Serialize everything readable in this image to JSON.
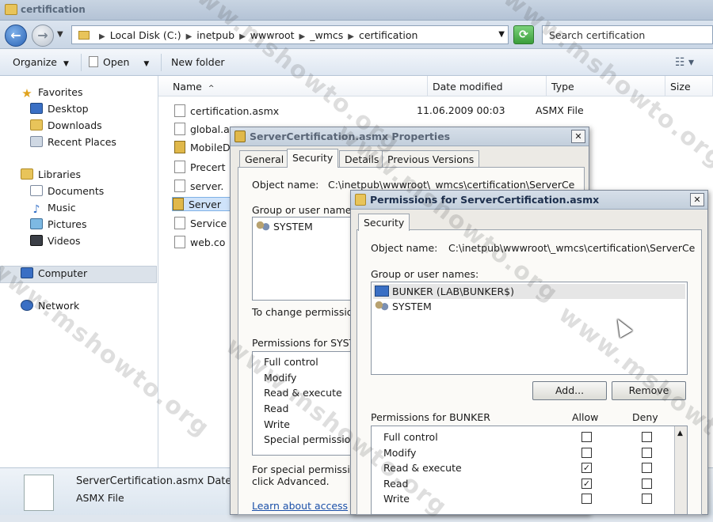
{
  "window": {
    "title": "certification"
  },
  "address": {
    "crumbs": [
      "Local Disk (C:)",
      "inetpub",
      "wwwroot",
      "_wmcs",
      "certification"
    ],
    "search_placeholder": "Search certification"
  },
  "toolbar": {
    "organize": "Organize",
    "open": "Open",
    "new_folder": "New folder"
  },
  "nav": {
    "favorites": "Favorites",
    "desktop": "Desktop",
    "downloads": "Downloads",
    "recent": "Recent Places",
    "libraries": "Libraries",
    "documents": "Documents",
    "music": "Music",
    "pictures": "Pictures",
    "videos": "Videos",
    "computer": "Computer",
    "network": "Network"
  },
  "columns": {
    "name": "Name",
    "date": "Date modified",
    "type": "Type",
    "size": "Size"
  },
  "files": [
    {
      "name": "certification.asmx",
      "date": "11.06.2009 00:03",
      "type": "ASMX File"
    },
    {
      "name": "global.a"
    },
    {
      "name": "MobileD"
    },
    {
      "name": "Precert"
    },
    {
      "name": "server."
    },
    {
      "name": "Server"
    },
    {
      "name": "Service"
    },
    {
      "name": "web.co"
    }
  ],
  "details": {
    "name": "ServerCertification.asmx  Date",
    "type": "ASMX File"
  },
  "properties": {
    "title": "ServerCertification.asmx Properties",
    "tabs": [
      "General",
      "Security",
      "Details",
      "Previous Versions"
    ],
    "object_label": "Object name:",
    "object_value": "C:\\inetpub\\wwwroot\\_wmcs\\certification\\ServerCe",
    "group_label": "Group or user names",
    "users": [
      "SYSTEM"
    ],
    "change_text": "To change permissio",
    "perms_for": "Permissions for SYST",
    "perms": [
      "Full control",
      "Modify",
      "Read & execute",
      "Read",
      "Write",
      "Special permission"
    ],
    "special_text_1": "For special permissio",
    "special_text_2": "click Advanced.",
    "learn_link": "Learn about access"
  },
  "permissions": {
    "title": "Permissions for ServerCertification.asmx",
    "tab": "Security",
    "object_label": "Object name:",
    "object_value": "C:\\inetpub\\wwwroot\\_wmcs\\certification\\ServerCe",
    "group_label": "Group or user names:",
    "users": [
      "BUNKER (LAB\\BUNKER$)",
      "SYSTEM"
    ],
    "add": "Add...",
    "remove": "Remove",
    "perms_for": "Permissions for BUNKER",
    "allow": "Allow",
    "deny": "Deny",
    "perms": [
      {
        "name": "Full control",
        "allow": false,
        "deny": false
      },
      {
        "name": "Modify",
        "allow": false,
        "deny": false
      },
      {
        "name": "Read & execute",
        "allow": true,
        "deny": false
      },
      {
        "name": "Read",
        "allow": true,
        "deny": false
      },
      {
        "name": "Write",
        "allow": false,
        "deny": false
      }
    ],
    "check_mark": "✓"
  },
  "watermark": "www.mshowto.org"
}
